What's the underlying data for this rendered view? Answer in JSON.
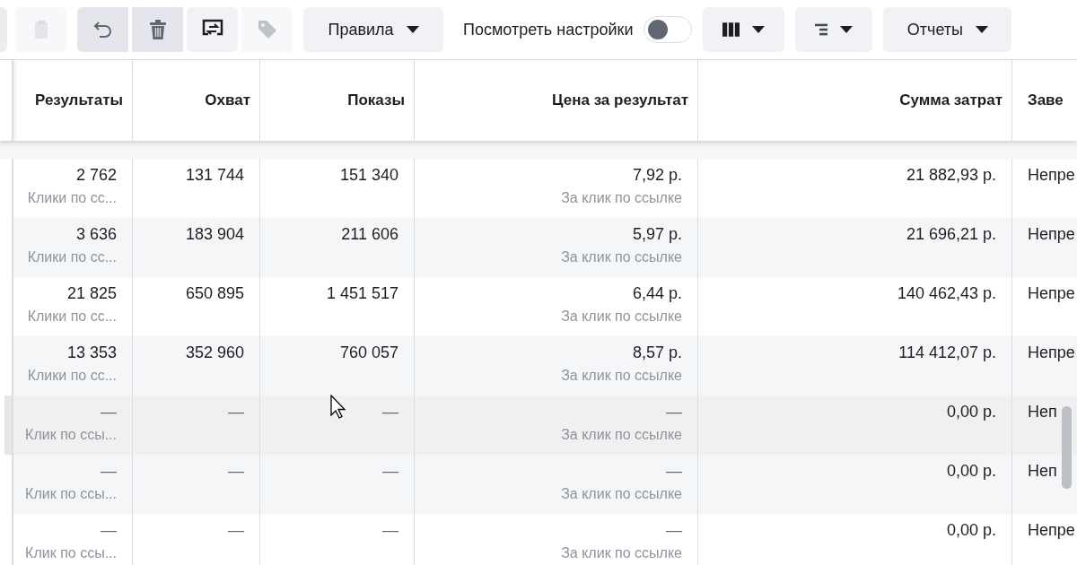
{
  "toolbar": {
    "icon_buttons": [
      {
        "disabled": true
      },
      {
        "disabled": false
      },
      {
        "disabled": false
      },
      {
        "disabled": false
      },
      {
        "disabled": true
      }
    ],
    "rules_button": "Правила",
    "view_settings": {
      "label": "Посмотреть настройки",
      "on": false
    },
    "reports_button": "Отчеты"
  },
  "table": {
    "columns": [
      "Результаты",
      "Охват",
      "Показы",
      "Цена за результат",
      "Сумма затрат",
      "Заве"
    ],
    "rows": [
      {
        "results": "2 762",
        "results_type": "Клики по сс...",
        "reach": "131 744",
        "impressions": "151 340",
        "cost": "7,92 р.",
        "cost_type": "За клик по ссылке",
        "spent": "21 882,93 р.",
        "column_6": "Непре",
        "highlighted": false
      },
      {
        "results": "3 636",
        "results_type": "Клики по сс...",
        "reach": "183 904",
        "impressions": "211 606",
        "cost": "5,97 р.",
        "cost_type": "За клик по ссылке",
        "spent": "21 696,21 р.",
        "column_6": "Непре",
        "highlighted": false
      },
      {
        "results": "21 825",
        "results_type": "Клики по сс...",
        "reach": "650 895",
        "impressions": "1 451 517",
        "cost": "6,44 р.",
        "cost_type": "За клик по ссылке",
        "spent": "140 462,43 р.",
        "column_6": "Непре",
        "highlighted": false
      },
      {
        "results": "13 353",
        "results_type": "Клики по сс...",
        "reach": "352 960",
        "impressions": "760 057",
        "cost": "8,57 р.",
        "cost_type": "За клик по ссылке",
        "spent": "114 412,07 р.",
        "column_6": "Непре",
        "highlighted": false
      },
      {
        "results": "—",
        "results_type": "Клик по ссы...",
        "reach": "—",
        "impressions": "—",
        "cost": "—",
        "cost_type": "За клик по ссылке",
        "spent": "0,00 р.",
        "column_6": "Неп",
        "highlighted": true
      },
      {
        "results": "—",
        "results_type": "Клик по ссы...",
        "reach": "—",
        "impressions": "—",
        "cost": "—",
        "cost_type": "За клик по ссылке",
        "spent": "0,00 р.",
        "column_6": "Неп",
        "highlighted": false
      },
      {
        "results": "—",
        "results_type": "Клик по ссы...",
        "reach": "—",
        "impressions": "—",
        "cost": "—",
        "cost_type": "За клик по ссылке",
        "spent": "0,00 р.",
        "column_6": "Непре",
        "highlighted": false
      }
    ]
  }
}
